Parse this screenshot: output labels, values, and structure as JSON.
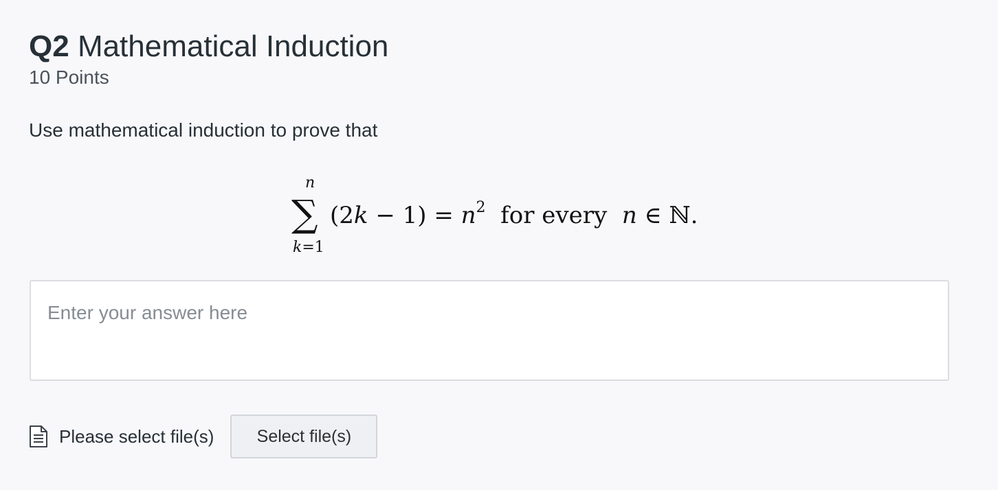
{
  "question": {
    "number": "Q2",
    "title": "Mathematical Induction",
    "points": "10 Points",
    "prompt": "Use mathematical induction to prove that"
  },
  "formula": {
    "sigma": "∑",
    "upper_limit": "n",
    "lower_limit_var": "k",
    "lower_limit_rest": "=1",
    "open": "(2",
    "k": "k",
    "minus_one": " − 1) = ",
    "n": "n",
    "exponent": "2",
    "for_every": "for every",
    "n2": "n",
    "in_set": " ∈ ℕ."
  },
  "answer": {
    "placeholder": "Enter your answer here",
    "value": ""
  },
  "upload": {
    "icon": "file-document-icon",
    "label": "Please select file(s)",
    "button_label": "Select file(s)"
  }
}
